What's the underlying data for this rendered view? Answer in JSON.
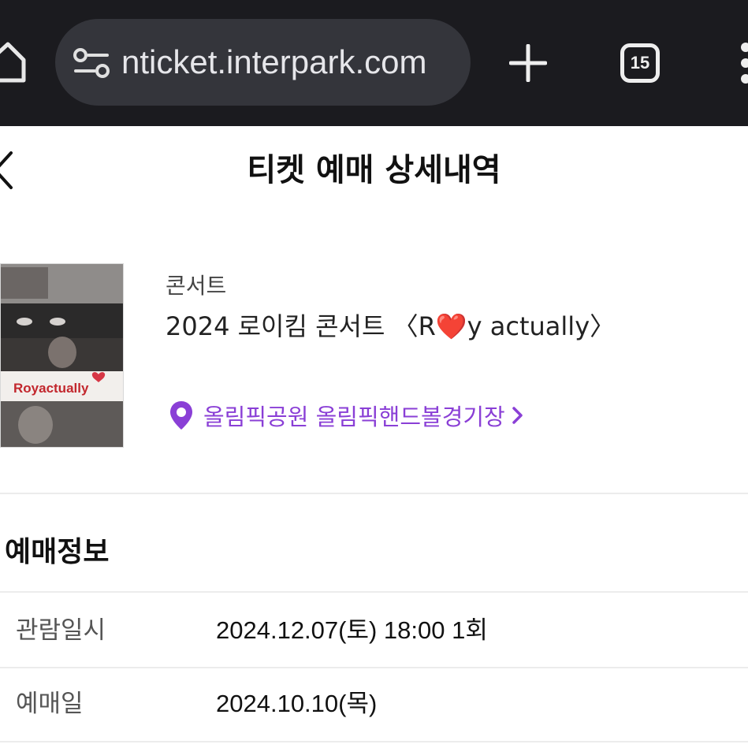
{
  "browser": {
    "url": "nticket.interpark.com",
    "tab_count": "15"
  },
  "header": {
    "title": "티켓 예매 상세내역"
  },
  "show": {
    "category": "콘서트",
    "title": "2024 로이킴 콘서트 〈R❤️y actually〉",
    "venue": "올림픽공원 올림픽핸드볼경기장",
    "poster_text": "Royactually"
  },
  "booking_info": {
    "section_title": "예매정보",
    "rows": [
      {
        "label": "관람일시",
        "value": "2024.12.07(토) 18:00 1회"
      },
      {
        "label": "예매일",
        "value": "2024.10.10(목)"
      }
    ]
  },
  "colors": {
    "browser_bg": "#1b1b1f",
    "url_pill": "#34353b",
    "accent_purple": "#8a3fd6"
  }
}
